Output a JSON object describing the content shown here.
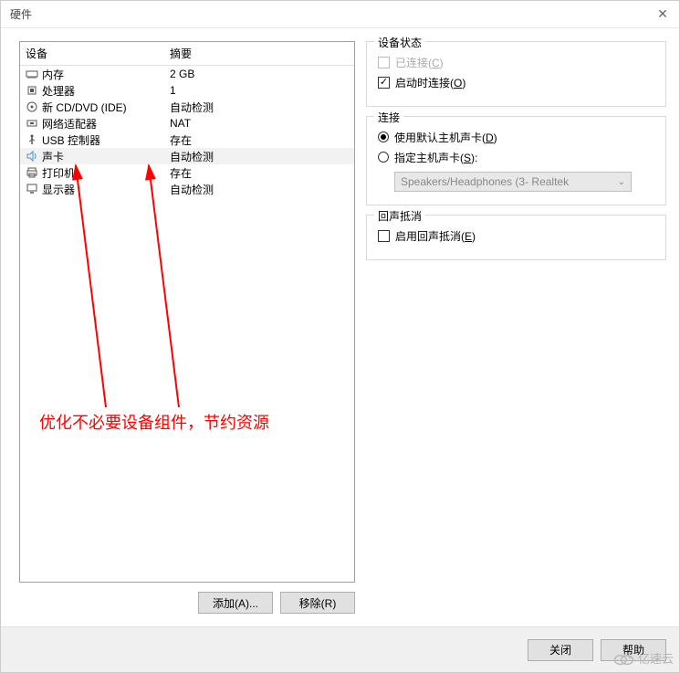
{
  "window": {
    "title": "硬件"
  },
  "table": {
    "headers": {
      "device": "设备",
      "summary": "摘要"
    },
    "rows": [
      {
        "id": "memory",
        "label": "内存",
        "summary": "2 GB",
        "selected": false
      },
      {
        "id": "cpu",
        "label": "处理器",
        "summary": "1",
        "selected": false
      },
      {
        "id": "cddvd",
        "label": "新 CD/DVD (IDE)",
        "summary": "自动检测",
        "selected": false
      },
      {
        "id": "network",
        "label": "网络适配器",
        "summary": "NAT",
        "selected": false
      },
      {
        "id": "usb",
        "label": "USB 控制器",
        "summary": "存在",
        "selected": false
      },
      {
        "id": "sound",
        "label": "声卡",
        "summary": "自动检测",
        "selected": true
      },
      {
        "id": "printer",
        "label": "打印机",
        "summary": "存在",
        "selected": false
      },
      {
        "id": "display",
        "label": "显示器",
        "summary": "自动检测",
        "selected": false
      }
    ]
  },
  "leftButtons": {
    "add": "添加(A)...",
    "remove": "移除(R)"
  },
  "status": {
    "title": "设备状态",
    "connected": "已连接(C)",
    "connectAtStart": "启动时连接(O)"
  },
  "connection": {
    "title": "连接",
    "useDefault": "使用默认主机声卡(D)",
    "specify": "指定主机声卡(S):",
    "dropdown": "Speakers/Headphones (3- Realtek"
  },
  "echo": {
    "title": "回声抵消",
    "enable": "启用回声抵消(E)"
  },
  "footer": {
    "close": "关闭",
    "help": "帮助"
  },
  "annotation": "优化不必要设备组件，节约资源",
  "watermark": "亿速云"
}
